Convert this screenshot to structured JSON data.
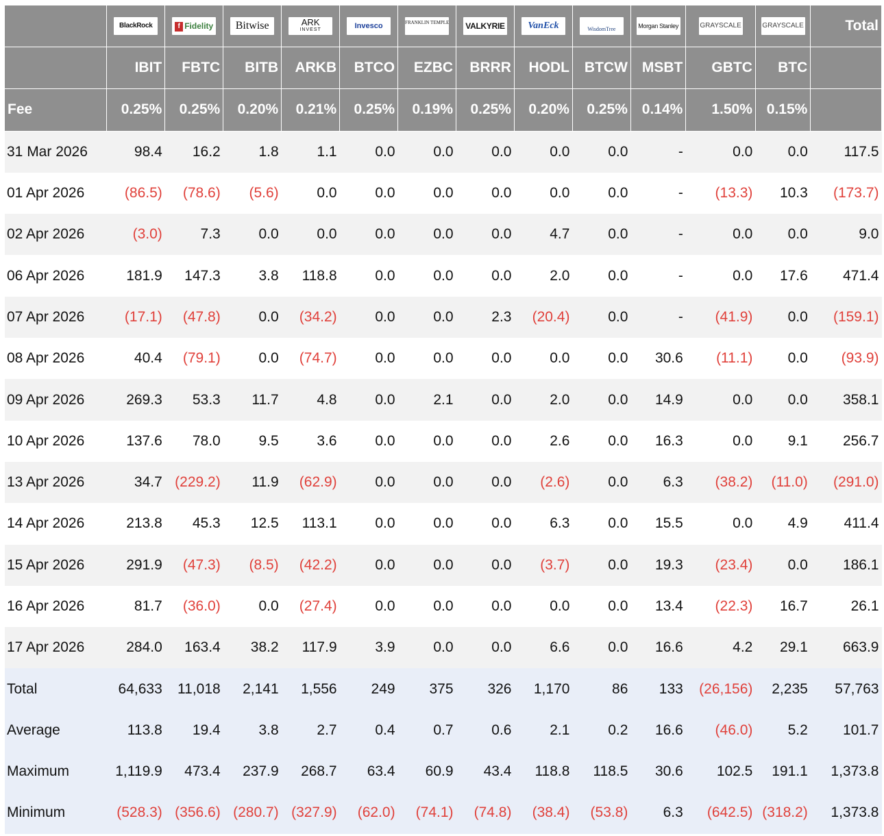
{
  "title": "Total",
  "fee_label": "Fee",
  "funds": [
    {
      "ticker": "IBIT",
      "fee": "0.25%",
      "logo": "BlackRock",
      "logo_icon": "blackrock-logo"
    },
    {
      "ticker": "FBTC",
      "fee": "0.25%",
      "logo": "Fidelity",
      "logo_icon": "fidelity-logo"
    },
    {
      "ticker": "BITB",
      "fee": "0.20%",
      "logo": "Bitwise",
      "logo_icon": "bitwise-logo"
    },
    {
      "ticker": "ARKB",
      "fee": "0.21%",
      "logo": "ARK",
      "logo_sub": "INVEST",
      "logo_icon": "ark-invest-logo"
    },
    {
      "ticker": "BTCO",
      "fee": "0.25%",
      "logo": "Invesco",
      "logo_icon": "invesco-logo"
    },
    {
      "ticker": "EZBC",
      "fee": "0.19%",
      "logo": "FRANKLIN TEMPLETON",
      "logo_icon": "franklin-templeton-logo"
    },
    {
      "ticker": "BRRR",
      "fee": "0.25%",
      "logo": "VALKYRIE",
      "logo_icon": "valkyrie-logo"
    },
    {
      "ticker": "HODL",
      "fee": "0.20%",
      "logo": "VanEck",
      "logo_icon": "vaneck-logo"
    },
    {
      "ticker": "BTCW",
      "fee": "0.25%",
      "logo": "WisdomTree",
      "logo_icon": "wisdomtree-logo"
    },
    {
      "ticker": "MSBT",
      "fee": "0.14%",
      "logo": "Morgan Stanley",
      "logo_icon": "morgan-stanley-logo"
    },
    {
      "ticker": "GBTC",
      "fee": "1.50%",
      "logo": "GRAYSCALE",
      "logo_icon": "grayscale-logo"
    },
    {
      "ticker": "BTC",
      "fee": "0.15%",
      "logo": "GRAYSCALE",
      "logo_icon": "grayscale-logo"
    }
  ],
  "rows": [
    {
      "date": "31 Mar 2026",
      "values": [
        "98.4",
        "16.2",
        "1.8",
        "1.1",
        "0.0",
        "0.0",
        "0.0",
        "0.0",
        "0.0",
        "-",
        "0.0",
        "0.0"
      ],
      "total": "117.5"
    },
    {
      "date": "01 Apr 2026",
      "values": [
        "(86.5)",
        "(78.6)",
        "(5.6)",
        "0.0",
        "0.0",
        "0.0",
        "0.0",
        "0.0",
        "0.0",
        "-",
        "(13.3)",
        "10.3"
      ],
      "total": "(173.7)"
    },
    {
      "date": "02 Apr 2026",
      "values": [
        "(3.0)",
        "7.3",
        "0.0",
        "0.0",
        "0.0",
        "0.0",
        "0.0",
        "4.7",
        "0.0",
        "-",
        "0.0",
        "0.0"
      ],
      "total": "9.0"
    },
    {
      "date": "06 Apr 2026",
      "values": [
        "181.9",
        "147.3",
        "3.8",
        "118.8",
        "0.0",
        "0.0",
        "0.0",
        "2.0",
        "0.0",
        "-",
        "0.0",
        "17.6"
      ],
      "total": "471.4"
    },
    {
      "date": "07 Apr 2026",
      "values": [
        "(17.1)",
        "(47.8)",
        "0.0",
        "(34.2)",
        "0.0",
        "0.0",
        "2.3",
        "(20.4)",
        "0.0",
        "-",
        "(41.9)",
        "0.0"
      ],
      "total": "(159.1)"
    },
    {
      "date": "08 Apr 2026",
      "values": [
        "40.4",
        "(79.1)",
        "0.0",
        "(74.7)",
        "0.0",
        "0.0",
        "0.0",
        "0.0",
        "0.0",
        "30.6",
        "(11.1)",
        "0.0"
      ],
      "total": "(93.9)"
    },
    {
      "date": "09 Apr 2026",
      "values": [
        "269.3",
        "53.3",
        "11.7",
        "4.8",
        "0.0",
        "2.1",
        "0.0",
        "2.0",
        "0.0",
        "14.9",
        "0.0",
        "0.0"
      ],
      "total": "358.1"
    },
    {
      "date": "10 Apr 2026",
      "values": [
        "137.6",
        "78.0",
        "9.5",
        "3.6",
        "0.0",
        "0.0",
        "0.0",
        "2.6",
        "0.0",
        "16.3",
        "0.0",
        "9.1"
      ],
      "total": "256.7"
    },
    {
      "date": "13 Apr 2026",
      "values": [
        "34.7",
        "(229.2)",
        "11.9",
        "(62.9)",
        "0.0",
        "0.0",
        "0.0",
        "(2.6)",
        "0.0",
        "6.3",
        "(38.2)",
        "(11.0)"
      ],
      "total": "(291.0)"
    },
    {
      "date": "14 Apr 2026",
      "values": [
        "213.8",
        "45.3",
        "12.5",
        "113.1",
        "0.0",
        "0.0",
        "0.0",
        "6.3",
        "0.0",
        "15.5",
        "0.0",
        "4.9"
      ],
      "total": "411.4"
    },
    {
      "date": "15 Apr 2026",
      "values": [
        "291.9",
        "(47.3)",
        "(8.5)",
        "(42.2)",
        "0.0",
        "0.0",
        "0.0",
        "(3.7)",
        "0.0",
        "19.3",
        "(23.4)",
        "0.0"
      ],
      "total": "186.1"
    },
    {
      "date": "16 Apr 2026",
      "values": [
        "81.7",
        "(36.0)",
        "0.0",
        "(27.4)",
        "0.0",
        "0.0",
        "0.0",
        "0.0",
        "0.0",
        "13.4",
        "(22.3)",
        "16.7"
      ],
      "total": "26.1"
    },
    {
      "date": "17 Apr 2026",
      "values": [
        "284.0",
        "163.4",
        "38.2",
        "117.9",
        "3.9",
        "0.0",
        "0.0",
        "6.6",
        "0.0",
        "16.6",
        "4.2",
        "29.1"
      ],
      "total": "663.9"
    }
  ],
  "summary": [
    {
      "label": "Total",
      "values": [
        "64,633",
        "11,018",
        "2,141",
        "1,556",
        "249",
        "375",
        "326",
        "1,170",
        "86",
        "133",
        "(26,156)",
        "2,235"
      ],
      "total": "57,763"
    },
    {
      "label": "Average",
      "values": [
        "113.8",
        "19.4",
        "3.8",
        "2.7",
        "0.4",
        "0.7",
        "0.6",
        "2.1",
        "0.2",
        "16.6",
        "(46.0)",
        "5.2"
      ],
      "total": "101.7"
    },
    {
      "label": "Maximum",
      "values": [
        "1,119.9",
        "473.4",
        "237.9",
        "268.7",
        "63.4",
        "60.9",
        "43.4",
        "118.8",
        "118.5",
        "30.6",
        "102.5",
        "191.1"
      ],
      "total": "1,373.8"
    },
    {
      "label": "Minimum",
      "values": [
        "(528.3)",
        "(356.6)",
        "(280.7)",
        "(327.9)",
        "(62.0)",
        "(74.1)",
        "(74.8)",
        "(38.4)",
        "(53.8)",
        "6.3",
        "(642.5)",
        "(318.2)"
      ],
      "total": "1,373.8"
    }
  ],
  "colors": {
    "header_bg": "#8f8f8f",
    "negative": "#e0403a",
    "summary_bg": "#e9eef8",
    "row_alt": "#f2f2f2"
  }
}
